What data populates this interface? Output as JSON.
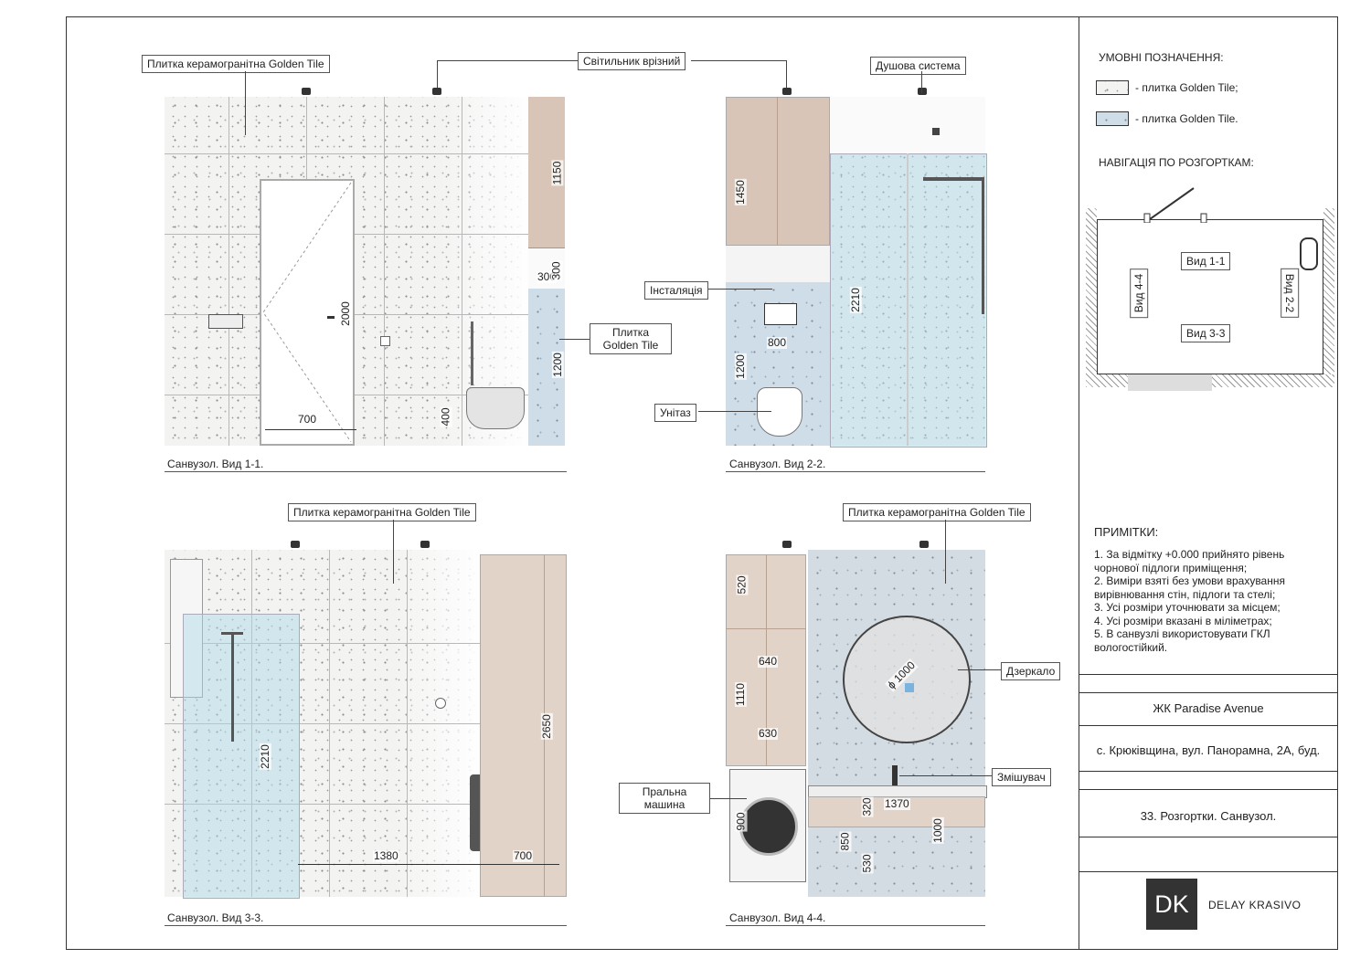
{
  "views": {
    "v11": {
      "caption": "Санвузол. Вид 1-1.",
      "tag_tile": "Плитка керамогранітна Golden Tile",
      "tag_light": "Світильник врізний",
      "tag_golden_line1": "Плитка",
      "tag_golden_line2": "Golden Tile",
      "dims": {
        "d1150": "1150",
        "d300a": "300",
        "d300b": "300",
        "d2000": "2000",
        "d1200": "1200",
        "d400": "400",
        "d700": "700"
      }
    },
    "v22": {
      "caption": "Санвузол. Вид 2-2.",
      "tag_shower": "Душова система",
      "tag_install": "Інсталяція",
      "tag_toilet": "Унітаз",
      "dims": {
        "d1450": "1450",
        "d2210": "2210",
        "d800": "800",
        "d1200": "1200"
      }
    },
    "v33": {
      "caption": "Санвузол. Вид 3-3.",
      "tag_tile": "Плитка керамогранітна Golden Tile",
      "dims": {
        "d2210": "2210",
        "d2650": "2650",
        "d1380": "1380",
        "d700": "700"
      }
    },
    "v44": {
      "caption": "Санвузол. Вид 4-4.",
      "tag_tile": "Плитка керамогранітна Golden Tile",
      "tag_mirror": "Дзеркало",
      "tag_mixer": "Змішувач",
      "tag_washer_line1": "Пральна",
      "tag_washer_line2": "машина",
      "dims": {
        "d520": "520",
        "d640": "640",
        "d1110": "1110",
        "d630": "630",
        "d1000dia": "ϕ 1000",
        "d320": "320",
        "d1370": "1370",
        "d900": "900",
        "d850": "850",
        "d1000": "1000",
        "d530": "530"
      }
    }
  },
  "sidebar": {
    "legend_title": "УМОВНІ ПОЗНАЧЕННЯ:",
    "legend_item1": "- плитка Golden Tile;",
    "legend_item2": "- плитка Golden Tile.",
    "nav_title": "НАВІГАЦІЯ ПО РОЗГОРТКАМ:",
    "nav_v11": "Вид 1-1",
    "nav_v22": "Вид 2-2",
    "nav_v33": "Вид 3-3",
    "nav_v44": "Вид 4-4",
    "notes_title": "ПРИМІТКИ:",
    "notes": [
      "1. За відмітку +0.000 прийнято рівень",
      "чорнової підлоги приміщення;",
      "2. Виміри взяті без умови врахування",
      "вирівнювання стін, підлоги та стелі;",
      "3. Усі розміри уточнювати за місцем;",
      "4. Усі розміри вказані в міліметрах;",
      "5. В санвузлі використовувати ГКЛ",
      "вологостійкий."
    ],
    "project": "ЖК Paradise Avenue",
    "address": "с. Крюківщина, вул. Панорамна, 2А, буд.",
    "sheet": "33. Розгортки. Санвузол.",
    "logo": "DK",
    "brand": "DELAY KRASIVO"
  },
  "colors": {
    "tile": "#f3f3f2",
    "tile_blue": "#cfdde9",
    "wood": "#d8c5b8",
    "glass": "#aad7e8"
  }
}
